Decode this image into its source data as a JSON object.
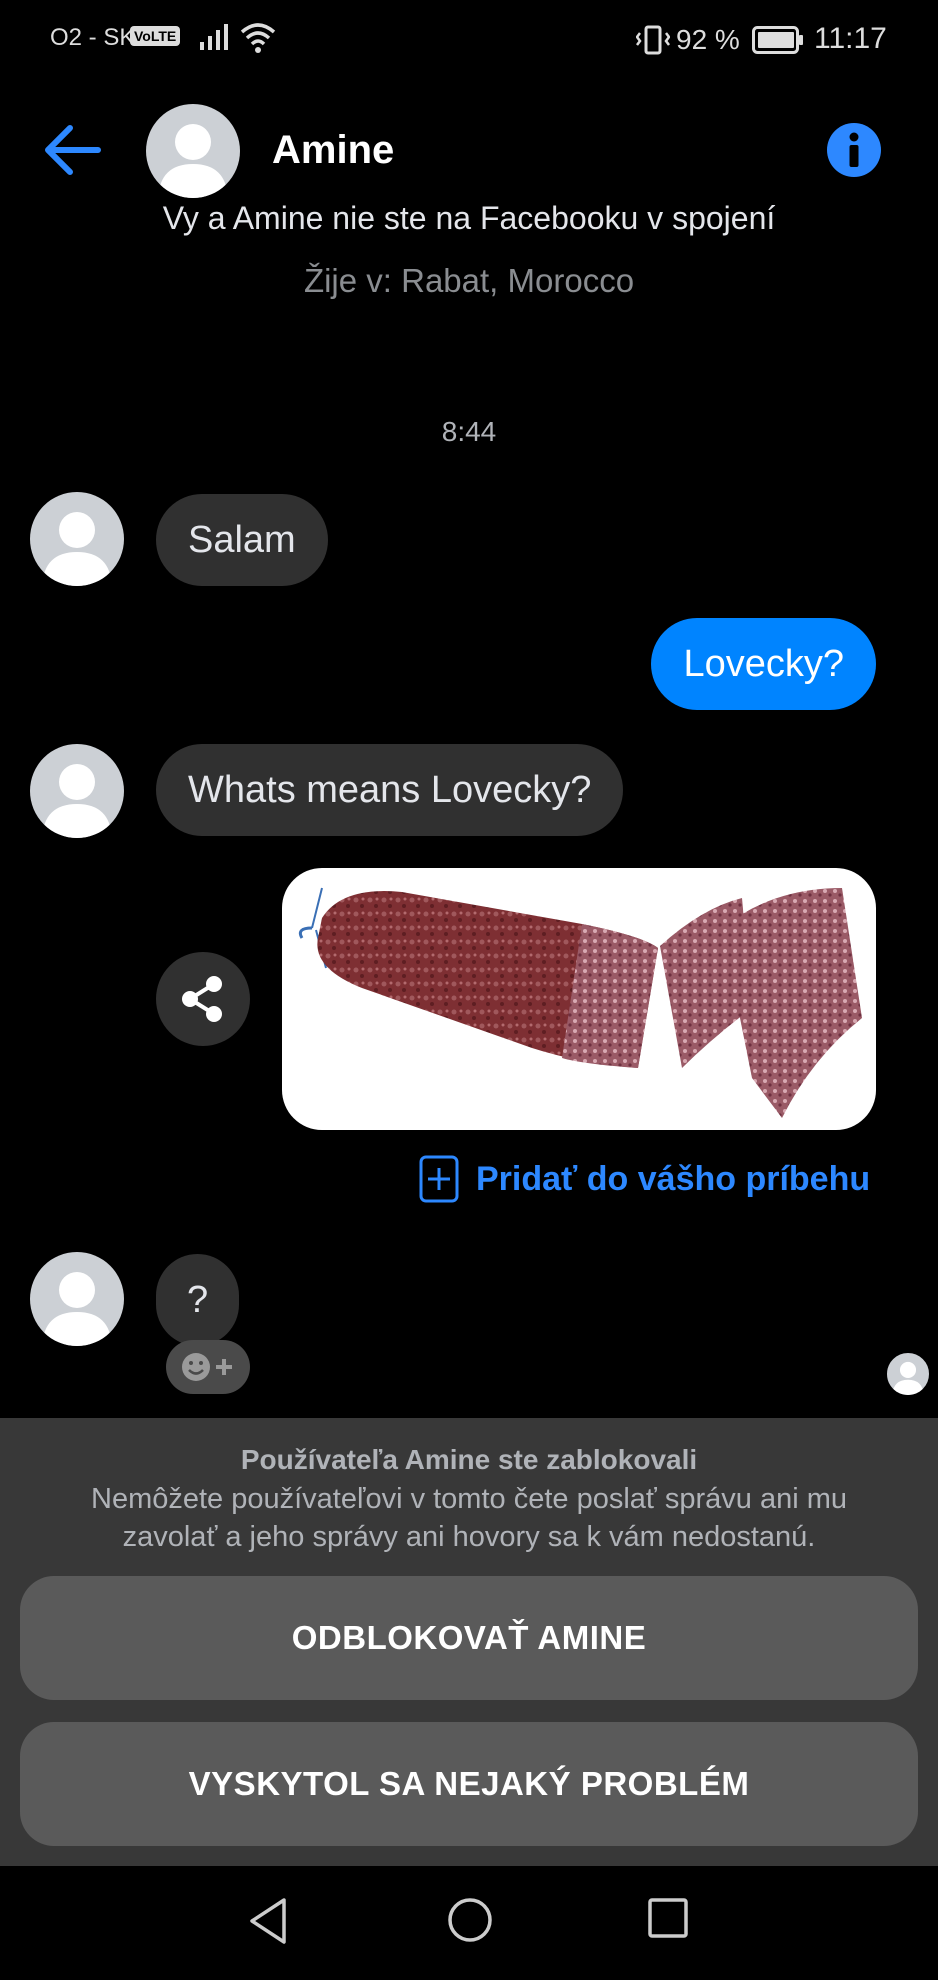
{
  "status_bar": {
    "carrier": "O2 - SK",
    "volte": "VoLTE",
    "battery": "92 %",
    "time": "11:17"
  },
  "header": {
    "contact_name": "Amine",
    "back_icon": "arrow-left-icon",
    "info_icon": "info-icon"
  },
  "profile_context": {
    "connection_text": "Vy a Amine nie ste na Facebooku v spojení",
    "lives_in": "Žije v: Rabat, Morocco"
  },
  "thread": {
    "timestamp": "8:44",
    "messages": [
      {
        "from": "contact",
        "text": "Salam"
      },
      {
        "from": "me",
        "text": "Lovecky?"
      },
      {
        "from": "contact",
        "text": "Whats means Lovecky?"
      },
      {
        "from": "me",
        "type": "image",
        "image_desc": "sausage"
      },
      {
        "from": "contact",
        "text": "?"
      }
    ],
    "add_story_label": "Pridať do vášho príbehu"
  },
  "blocked_panel": {
    "title": "Používateľa Amine ste zablokovali",
    "description": "Nemôžete používateľovi v tomto čete poslať správu ani mu zavolať a jeho správy ani hovory sa k vám nedostanú.",
    "unblock_label": "ODBLOKOVAŤ AMINE",
    "problem_label": "VYSKYTOL SA NEJAKÝ PROBLÉM"
  },
  "colors": {
    "accent": "#0084ff",
    "incoming_bubble": "#303030",
    "panel": "#383838",
    "panel_button": "#5a5a5a"
  }
}
